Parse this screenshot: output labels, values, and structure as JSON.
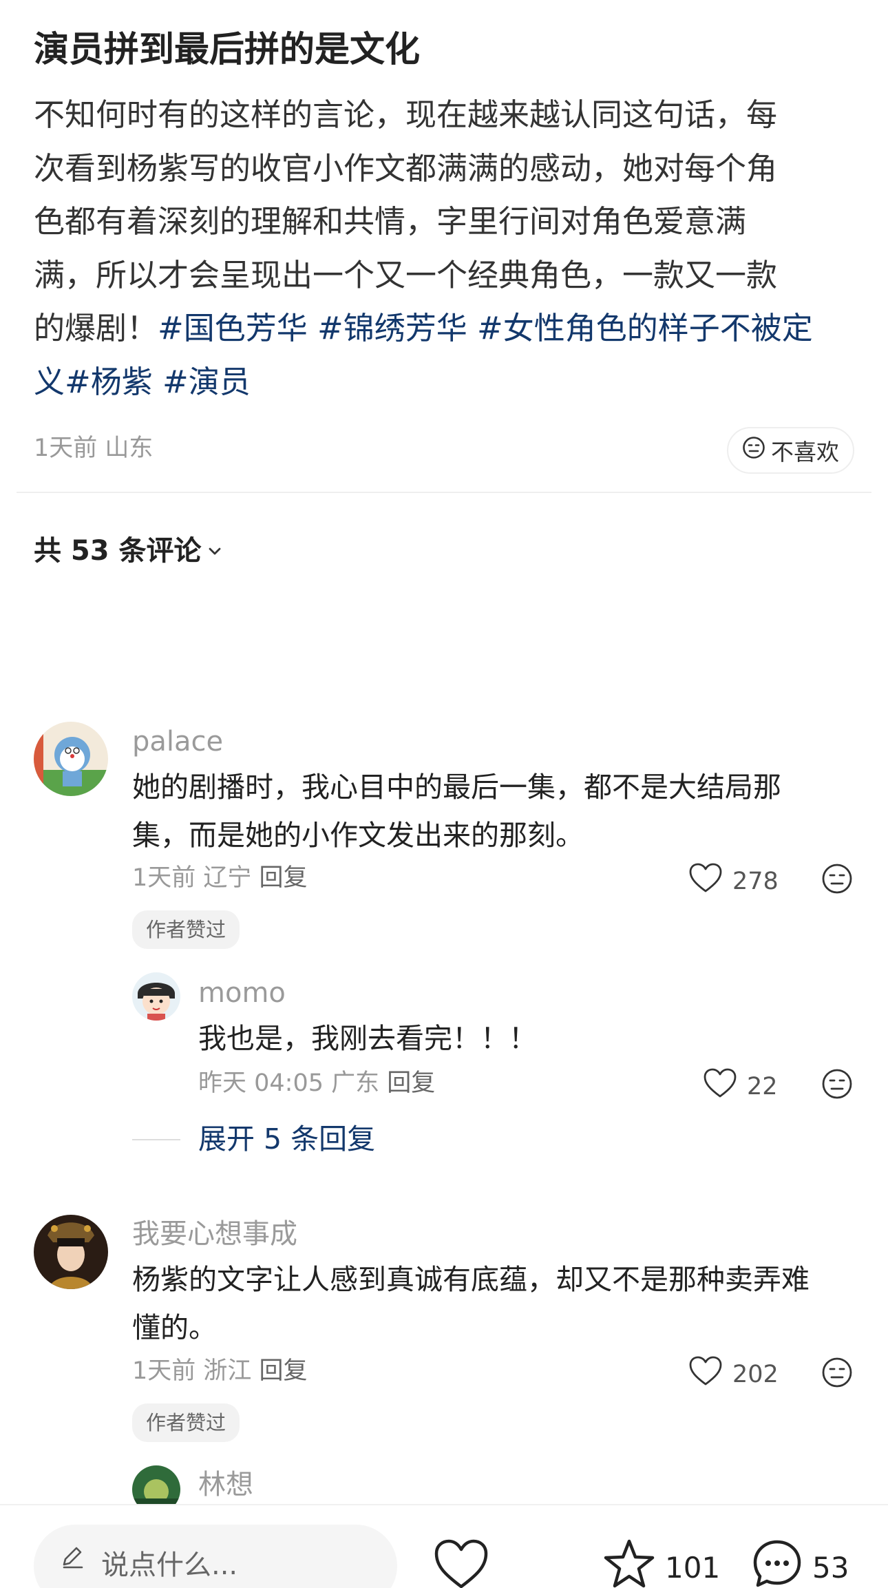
{
  "post": {
    "title": "演员拼到最后拼的是文化",
    "body_lines": [
      "不知何时有的这样的言论，现在越来越认同这句话，每",
      "次看到杨紫写的收官小作文都满满的感动，她对每个角",
      "色都有着深刻的理解和共情，字里行间对角色爱意满",
      "满，所以才会呈现出一个又一个经典角色，一款又一款"
    ],
    "line5_text": "的爆剧！",
    "line5_tags": "#国色芳华 #锦绣芳华 #女性角色的样子不被定",
    "line6_tags": "义#杨紫 #演员",
    "meta": "1天前 山东",
    "dislike_label": "不喜欢"
  },
  "comments_header": {
    "label": "共 53 条评论"
  },
  "comments": [
    {
      "name": "palace",
      "text_lines": [
        "她的剧播时，我心目中的最后一集，都不是大结局那",
        "集，而是她的小作文发出来的那刻。"
      ],
      "meta": "1天前 辽宁",
      "reply": "回复",
      "likes": "278",
      "badge": "作者赞过"
    },
    {
      "name": "momo",
      "text_lines": [
        "我也是，我刚去看完！！！"
      ],
      "meta": "昨天 04:05 广东",
      "reply": "回复",
      "likes": "22"
    },
    {
      "name": "我要心想事成",
      "text_lines": [
        "杨紫的文字让人感到真诚有底蕴，却又不是那种卖弄难",
        "懂的。"
      ],
      "meta": "1天前 浙江",
      "reply": "回复",
      "likes": "202",
      "badge": "作者赞过"
    },
    {
      "name": "林想"
    }
  ],
  "expand_replies": "展开 5 条回复",
  "bottom_bar": {
    "input_placeholder": "说点什么...",
    "star_count": "101",
    "comment_count": "53"
  },
  "colors": {
    "tag": "#13386c",
    "muted": "#999999"
  }
}
